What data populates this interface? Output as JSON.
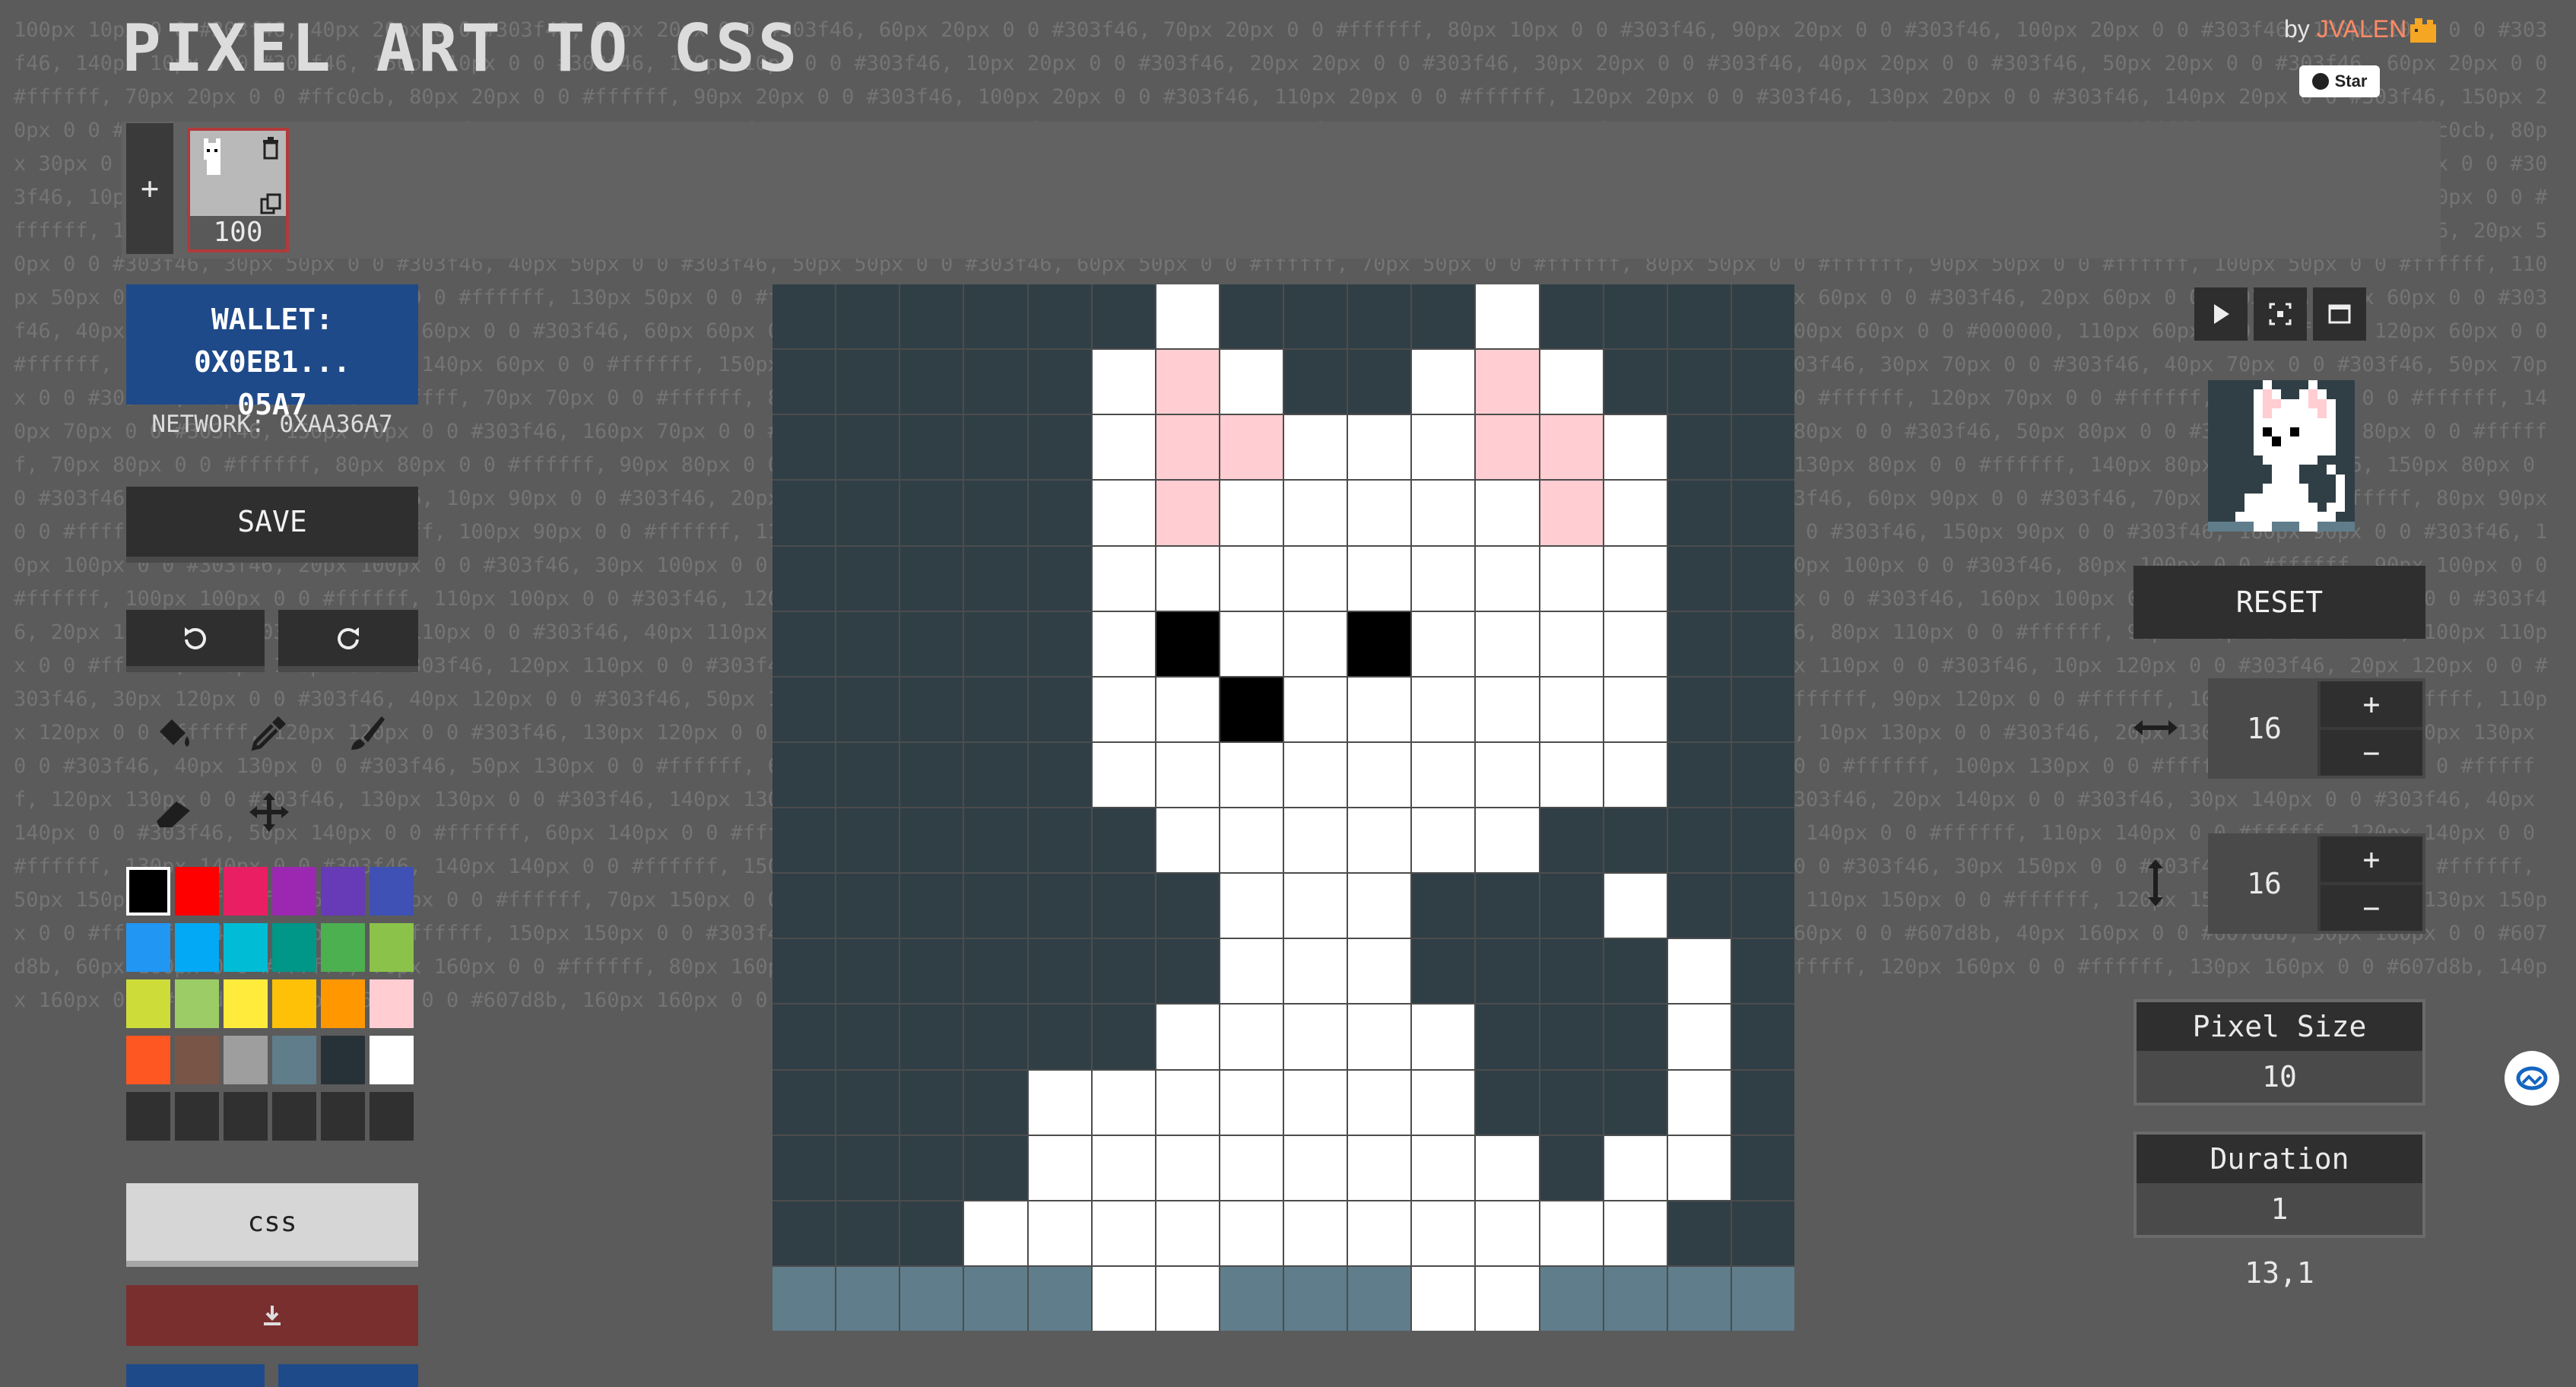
{
  "background_code": "100px 10px 0 0 #303f46, 40px 20px 0 0 #303f46, 50px 20px 0 0 #303f46, 60px 20px 0 0 #303f46, 70px 20px 0 0 #ffffff, 80px 10px 0 0 #303f46, 90px 20px 0 0 #303f46, 100px 20px 0 0 #303f46, 130px 10px 0 0 #303f46, 140px 10px 0 0 #303f46, 150px 10px 0 0 #303f46, 160px 10px 0 0 #303f46, 10px 20px 0 0 #303f46, 20px 20px 0 0 #303f46, 30px 20px 0 0 #303f46, 40px 20px 0 0 #303f46, 50px 20px 0 0 #303f46, 60px 20px 0 0 #ffffff, 70px 20px 0 0 #ffc0cb, 80px 20px 0 0 #ffffff, 90px 20px 0 0 #303f46, 100px 20px 0 0 #303f46, 110px 20px 0 0 #ffffff, 120px 20px 0 0 #303f46, 130px 20px 0 0 #303f46, 140px 20px 0 0 #303f46, 150px 20px 0 0 #303f46, 160px 20px 0 0 #303f46, 10px 30px 0 0 #303f46, 20px 30px 0 0 #303f46, 30px 30px 0 0 #303f46, 40px 30px 0 0 #303f46, 50px 30px 0 0 #303f46, 60px 30px 0 0 #ffffff, 70px 30px 0 0 #ffc0cb, 80px 30px 0 0 #ffc0cb, 90px 30px 0 0 #ffffff, 100px 30px 0 0 #ffffff, 110px 30px 0 0 #ffffff, 120px 30px 0 0 #ffc0cb, 130px 30px 0 0 #ffffff, 140px 30px 0 0 #303f46, 150px 30px 0 0 #303f46, 160px 30px 0 0 #303f46, 10px 40px 0 0 #303f46, 20px 40px 0 0 #303f46, 30px 40px 0 0 #303f46, 40px 40px 0 0 #303f46, 50px 40px 0 0 #303f46, 60px 40px 0 0 #ffffff, 70px 40px 0 0 #ffc0cb, 80px 40px 0 0 #ffffff, 90px 40px 0 0 #ffffff, 100px 40px 0 0 #ffffff, 110px 40px 0 0 #ffffff, 120px 40px 0 0 #ffffff, 130px 40px 0 0 #ffc0cb, 140px 40px 0 0 #ffffff, 150px 40px 0 0 #303f46, 160px 40px 0 0 #303f46, 10px 50px 0 0 #303f46, 20px 50px 0 0 #303f46, 30px 50px 0 0 #303f46, 40px 50px 0 0 #303f46, 50px 50px 0 0 #303f46, 60px 50px 0 0 #ffffff, 70px 50px 0 0 #ffffff, 80px 50px 0 0 #ffffff, 90px 50px 0 0 #ffffff, 100px 50px 0 0 #ffffff, 110px 50px 0 0 #ffffff, 120px 50px 0 0 #ffffff, 130px 50px 0 0 #ffffff, 140px 50px 0 0 #ffffff, 150px 50px 0 0 #303f46, 160px 50px 0 0 #303f46, 10px 60px 0 0 #303f46, 20px 60px 0 0 #303f46, 30px 60px 0 0 #303f46, 40px 60px 0 0 #303f46, 50px 60px 0 0 #303f46, 60px 60px 0 0 #ffffff, 70px 60px 0 0 #000000, 80px 60px 0 0 #ffffff, 90px 60px 0 0 #ffffff, 100px 60px 0 0 #000000, 110px 60px 0 0 #ffffff, 120px 60px 0 0 #ffffff, 130px 60px 0 0 #ffffff, 140px 60px 0 0 #ffffff, 150px 60px 0 0 #303f46, 160px 60px 0 0 #303f46, 10px 70px 0 0 #303f46, 20px 70px 0 0 #303f46, 30px 70px 0 0 #303f46, 40px 70px 0 0 #303f46, 50px 70px 0 0 #303f46, 60px 70px 0 0 #ffffff, 70px 70px 0 0 #ffffff, 80px 70px 0 0 #000000, 90px 70px 0 0 #ffffff, 100px 70px 0 0 #ffffff, 110px 70px 0 0 #ffffff, 120px 70px 0 0 #ffffff, 130px 70px 0 0 #ffffff, 140px 70px 0 0 #303f46, 150px 70px 0 0 #303f46, 160px 70px 0 0 #303f46, 10px 80px 0 0 #303f46, 20px 80px 0 0 #303f46, 30px 80px 0 0 #303f46, 40px 80px 0 0 #303f46, 50px 80px 0 0 #303f46, 60px 80px 0 0 #ffffff, 70px 80px 0 0 #ffffff, 80px 80px 0 0 #ffffff, 90px 80px 0 0 #ffffff, 100px 80px 0 0 #ffffff, 110px 80px 0 0 #ffffff, 120px 80px 0 0 #ffffff, 130px 80px 0 0 #ffffff, 140px 80px 0 0 #303f46, 150px 80px 0 0 #303f46, 160px 80px 0 0 #303f46, 10px 90px 0 0 #303f46, 20px 90px 0 0 #303f46, 30px 90px 0 0 #303f46, 40px 90px 0 0 #303f46, 50px 90px 0 0 #303f46, 60px 90px 0 0 #303f46, 70px 90px 0 0 #ffffff, 80px 90px 0 0 #ffffff, 90px 90px 0 0 #ffffff, 100px 90px 0 0 #ffffff, 110px 90px 0 0 #ffffff, 120px 90px 0 0 #ffffff, 130px 90px 0 0 #303f46, 140px 90px 0 0 #303f46, 150px 90px 0 0 #303f46, 160px 90px 0 0 #303f46, 10px 100px 0 0 #303f46, 20px 100px 0 0 #303f46, 30px 100px 0 0 #303f46, 40px 100px 0 0 #303f46, 50px 100px 0 0 #303f46, 60px 100px 0 0 #303f46, 70px 100px 0 0 #303f46, 80px 100px 0 0 #ffffff, 90px 100px 0 0 #ffffff, 100px 100px 0 0 #ffffff, 110px 100px 0 0 #303f46, 120px 100px 0 0 #303f46, 130px 100px 0 0 #303f46, 140px 100px 0 0 #ffffff, 150px 100px 0 0 #303f46, 160px 100px 0 0 #303f46, 10px 110px 0 0 #303f46, 20px 110px 0 0 #303f46, 30px 110px 0 0 #303f46, 40px 110px 0 0 #303f46, 50px 110px 0 0 #303f46, 60px 110px 0 0 #303f46, 70px 110px 0 0 #303f46, 80px 110px 0 0 #ffffff, 90px 110px 0 0 #ffffff, 100px 110px 0 0 #ffffff, 110px 110px 0 0 #303f46, 120px 110px 0 0 #303f46, 130px 110px 0 0 #303f46, 140px 110px 0 0 #303f46, 150px 110px 0 0 #ffffff, 160px 110px 0 0 #303f46, 10px 120px 0 0 #303f46, 20px 120px 0 0 #303f46, 30px 120px 0 0 #303f46, 40px 120px 0 0 #303f46, 50px 120px 0 0 #303f46, 60px 120px 0 0 #303f46, 70px 120px 0 0 #ffffff, 80px 120px 0 0 #ffffff, 90px 120px 0 0 #ffffff, 100px 120px 0 0 #ffffff, 110px 120px 0 0 #ffffff, 120px 120px 0 0 #303f46, 130px 120px 0 0 #303f46, 140px 120px 0 0 #303f46, 150px 120px 0 0 #ffffff, 160px 120px 0 0 #303f46, 10px 130px 0 0 #303f46, 20px 130px 0 0 #303f46, 30px 130px 0 0 #303f46, 40px 130px 0 0 #303f46, 50px 130px 0 0 #ffffff, 60px 130px 0 0 #ffffff, 70px 130px 0 0 #ffffff, 80px 130px 0 0 #ffffff, 90px 130px 0 0 #ffffff, 100px 130px 0 0 #ffffff, 110px 130px 0 0 #ffffff, 120px 130px 0 0 #303f46, 130px 130px 0 0 #303f46, 140px 130px 0 0 #303f46, 150px 130px 0 0 #ffffff, 160px 130px 0 0 #303f46, 10px 140px 0 0 #303f46, 20px 140px 0 0 #303f46, 30px 140px 0 0 #303f46, 40px 140px 0 0 #303f46, 50px 140px 0 0 #ffffff, 60px 140px 0 0 #ffffff, 70px 140px 0 0 #ffffff, 80px 140px 0 0 #ffffff, 90px 140px 0 0 #ffffff, 100px 140px 0 0 #ffffff, 110px 140px 0 0 #ffffff, 120px 140px 0 0 #ffffff, 130px 140px 0 0 #303f46, 140px 140px 0 0 #ffffff, 150px 140px 0 0 #ffffff, 160px 140px 0 0 #303f46, 10px 150px 0 0 #303f46, 20px 150px 0 0 #303f46, 30px 150px 0 0 #303f46, 40px 150px 0 0 #ffffff, 50px 150px 0 0 #ffffff, 60px 150px 0 0 #ffffff, 70px 150px 0 0 #ffffff, 80px 150px 0 0 #ffffff, 90px 150px 0 0 #ffffff, 100px 150px 0 0 #ffffff, 110px 150px 0 0 #ffffff, 120px 150px 0 0 #ffffff, 130px 150px 0 0 #ffffff, 140px 150px 0 0 #ffffff, 150px 150px 0 0 #303f46, 160px 150px 0 0 #303f46, 10px 160px 0 0 #607d8b, 20px 160px 0 0 #607d8b, 30px 160px 0 0 #607d8b, 40px 160px 0 0 #607d8b, 50px 160px 0 0 #607d8b, 60px 160px 0 0 #ffffff, 70px 160px 0 0 #ffffff, 80px 160px 0 0 #607d8b, 90px 160px 0 0 #607d8b, 100px 160px 0 0 #607d8b, 110px 160px 0 0 #ffffff, 120px 160px 0 0 #ffffff, 130px 160px 0 0 #607d8b, 140px 160px 0 0 #607d8b, 150px 160px 0 0 #607d8b, 160px 160px 0 0 #607d8b",
  "header": {
    "title": "PIXEL ART TO CSS",
    "by": "by",
    "author": "JVALEN",
    "star": "Star"
  },
  "frames": [
    {
      "number": "100"
    }
  ],
  "add_frame_label": "+",
  "wallet": {
    "line1": "WALLET: 0X0EB1...",
    "line2": "05A7"
  },
  "network": "NETWORK: 0XAA36A7",
  "save_label": "SAVE",
  "palette": [
    "#000000",
    "#ff0000",
    "#e91e63",
    "#9c27b0",
    "#673ab7",
    "#3f51b5",
    "#2196f3",
    "#03a9f4",
    "#00bcd4",
    "#009688",
    "#4caf50",
    "#8bc34a",
    "#cddc39",
    "#9ccc65",
    "#ffeb3b",
    "#ffc107",
    "#ff9800",
    "#ffcdd2",
    "#ff5722",
    "#795548",
    "#9e9e9e",
    "#607d8b",
    "#263238",
    "#ffffff",
    "#303030",
    "#303030",
    "#303030",
    "#303030",
    "#303030",
    "#303030"
  ],
  "css_label": "css",
  "reset_label": "RESET",
  "width": {
    "value": "16",
    "plus": "+",
    "minus": "−"
  },
  "height": {
    "value": "16",
    "plus": "+",
    "minus": "−"
  },
  "pixel_size": {
    "label": "Pixel Size",
    "value": "10"
  },
  "duration": {
    "label": "Duration",
    "value": "1"
  },
  "coords": "13,1",
  "grid": {
    "palette": {
      "D": "#303f46",
      "W": "#ffffff",
      "P": "#ffcdd2",
      "K": "#000000",
      "B": "#607d8b"
    },
    "rows": [
      "DDDDDDWDDDDWDDDD",
      "DDDDDWPWDDWPWDDD",
      "DDDDDWPPWWWPPWDD",
      "DDDDDWPWWWWWPWDD",
      "DDDDDWWWWWWWWWDD",
      "DDDDDWKWWKWWWWDD",
      "DDDDDWWKWWWWWWDD",
      "DDDDDWWWWWWWWWDD",
      "DDDDDDWWWWWWDDDD",
      "DDDDDDDWWWDDDWDD",
      "DDDDDDDWWWDDDDWD",
      "DDDDDDWWWWWDDDWD",
      "DDDDWWWWWWWDDDWD",
      "DDDDWWWWWWWWDWWD",
      "DDDWWWWWWWWWWWDD",
      "BBBBBWWBBBWWBBBB"
    ]
  }
}
